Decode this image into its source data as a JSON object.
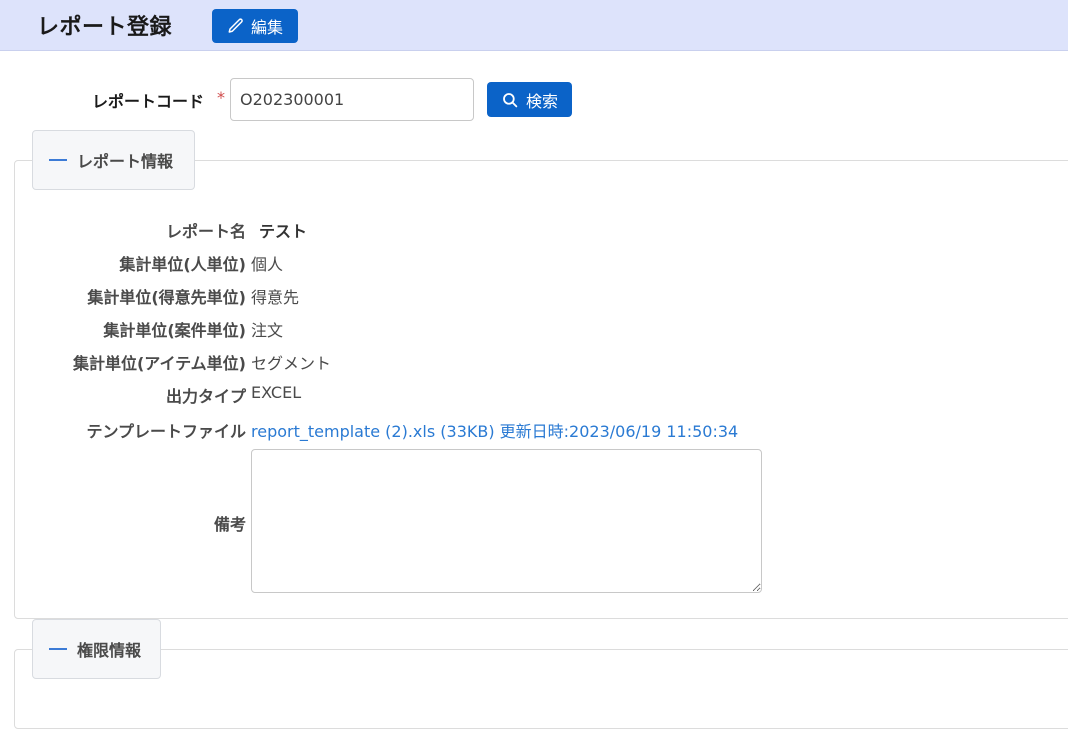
{
  "header": {
    "title": "レポート登録",
    "edit_label": "編集"
  },
  "code": {
    "label": "レポートコード",
    "required_mark": "*",
    "value": "O202300001",
    "search_label": "検索"
  },
  "sections": {
    "report_info": "レポート情報",
    "permission_info": "権限情報"
  },
  "fields": [
    {
      "label": "レポート名",
      "value": "テスト"
    },
    {
      "label": "集計単位(人単位)",
      "value": "個人"
    },
    {
      "label": "集計単位(得意先単位)",
      "value": "得意先"
    },
    {
      "label": "集計単位(案件単位)",
      "value": "注文"
    },
    {
      "label": "集計単位(アイテム単位)",
      "value": "セグメント"
    },
    {
      "label": "出力タイプ",
      "value": "EXCEL"
    },
    {
      "label": "テンプレートファイル",
      "value": "report_template (2).xls (33KB) 更新日時:2023/06/19 11:50:34"
    }
  ],
  "memo": {
    "label": "備考",
    "value": ""
  },
  "colors": {
    "header_bg": "#dde3fb",
    "primary": "#0b63c8",
    "link": "#2a7ad3",
    "required": "#d04a4a"
  },
  "icons": {
    "edit": "pencil-icon",
    "search": "search-icon",
    "collapse": "minus-icon"
  }
}
